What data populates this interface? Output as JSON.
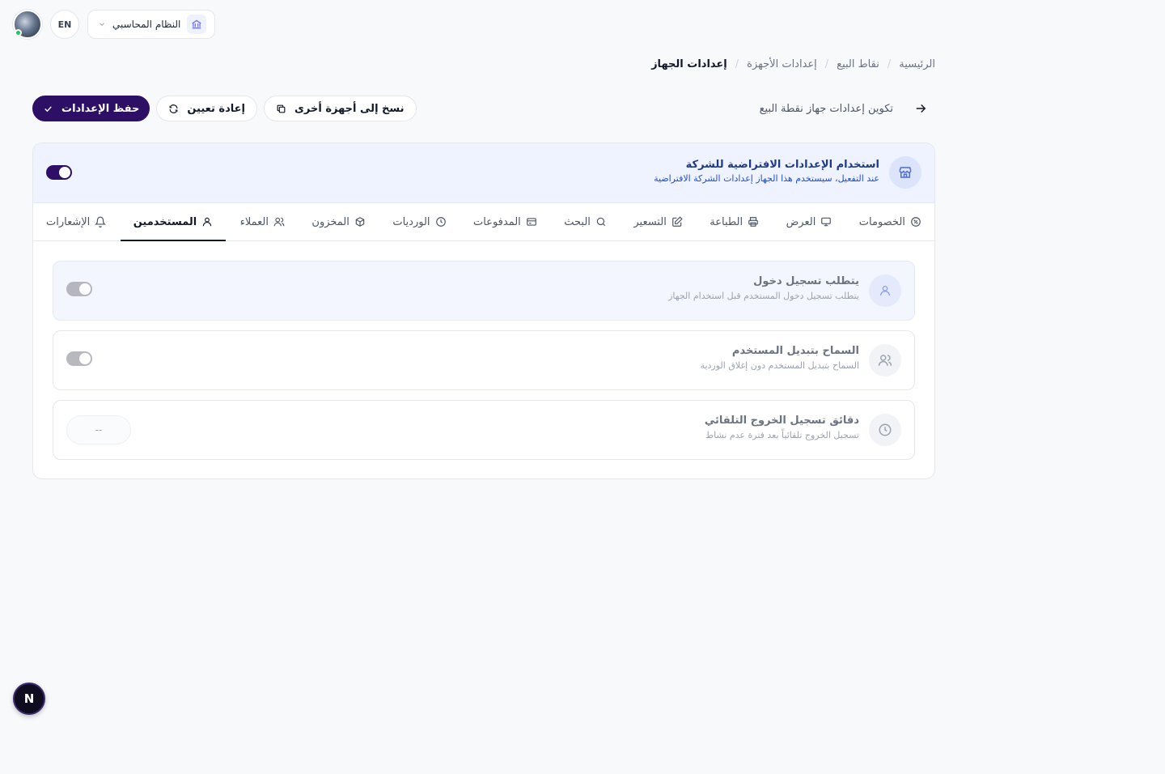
{
  "topbar": {
    "language": "EN",
    "system_name": "النظام المحاسبي",
    "user_status_color": "#22c55e"
  },
  "breadcrumb": {
    "items": [
      "الرئيسية",
      "نقاط البيع",
      "إعدادات الأجهزة"
    ],
    "current": "إعدادات الجهاز"
  },
  "header": {
    "subtitle": "تكوين إعدادات جهاز نقطة البيع",
    "save_label": "حفظ الإعدادات",
    "reset_label": "إعادة تعيين",
    "copy_label": "نسخ إلى أجهزة أخرى"
  },
  "defaults": {
    "title": "استخدام الإعدادات الافتراضية للشركة",
    "description": "عند التفعيل، سيستخدم هذا الجهاز إعدادات الشركة الافتراضية",
    "enabled": true
  },
  "tabs": [
    {
      "label": "الخصومات",
      "icon": "percent-icon"
    },
    {
      "label": "العرض",
      "icon": "monitor-icon"
    },
    {
      "label": "الطباعة",
      "icon": "printer-icon"
    },
    {
      "label": "التسعير",
      "icon": "edit-icon"
    },
    {
      "label": "البحث",
      "icon": "search-icon"
    },
    {
      "label": "المدفوعات",
      "icon": "credit-card-icon"
    },
    {
      "label": "الورديات",
      "icon": "clock-icon"
    },
    {
      "label": "المخزون",
      "icon": "box-icon"
    },
    {
      "label": "العملاء",
      "icon": "users-icon"
    },
    {
      "label": "المستخدمين",
      "icon": "user-icon",
      "active": true
    },
    {
      "label": "الإشعارات",
      "icon": "bell-icon"
    }
  ],
  "settings": {
    "require_login": {
      "title": "يتطلب تسجيل دخول",
      "description": "يتطلب تسجيل دخول المستخدم قبل استخدام الجهاز",
      "enabled": true
    },
    "allow_switch": {
      "title": "السماح بتبديل المستخدم",
      "description": "السماح بتبديل المستخدم دون إغلاق الوردية",
      "enabled": true
    },
    "auto_logout": {
      "title": "دقائق تسجيل الخروج التلقائي",
      "description": "تسجيل الخروج تلقائياً بعد فترة عدم نشاط",
      "value": "--"
    }
  },
  "fab": {
    "label": "N"
  },
  "colors": {
    "primary": "#2d1065",
    "accent_bg": "#eef3ff",
    "accent_text": "#1e3a8a"
  }
}
